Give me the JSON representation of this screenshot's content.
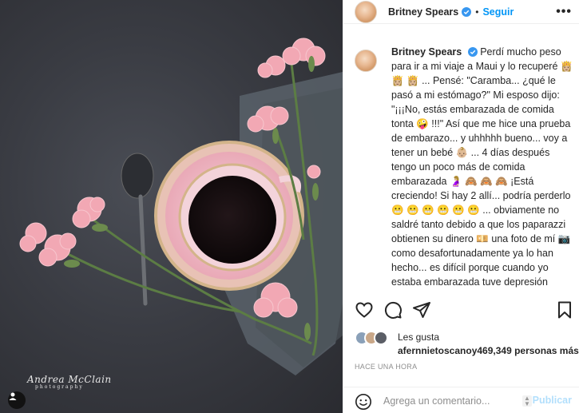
{
  "post": {
    "username": "Britney Spears",
    "follow_label": "Seguir",
    "separator": "•",
    "more_label": "•••",
    "caption": "Perdí mucho peso para ir a mi viaje a Maui y lo recuperé 👸🏼 👸🏼 👸🏼 ... Pensé: \"Caramba... ¿qué le pasó a mi estómago?\" Mi esposo dijo: \"¡¡¡No, estás embarazada de comida tonta 🤪 !!!\" Así que me hice una prueba de embarazo... y uhhhhh bueno... voy a tener un bebé 👶🏼 ... 4 días después tengo un poco más de comida embarazada 🤰🏼 🙈 🙈 🙈 ¡Está creciendo! Si hay 2 allí... podría perderlo 😬 😬 😬 😬 😬 😬 ... obviamente no saldré tanto debido a que los paparazzi obtienen su dinero 💴 una foto de mí 📷 como desafortunadamente ya lo han hecho... es difícil porque cuando yo estaba embarazada tuve depresión perinatal... tengo que decir que es absolutamente horrible 😢 ..."
  },
  "photo": {
    "watermark_name": "Andrea McClain",
    "watermark_sub": "photography"
  },
  "likes": {
    "label": "Les gusta",
    "first_user": "afernnietoscanoy",
    "count_text": "469,349 personas más"
  },
  "timestamp": "HACE UNA HORA",
  "comment": {
    "placeholder": "Agrega un comentario...",
    "publish_label": "Publicar"
  },
  "icons": [
    "verified-badge-icon",
    "more-options-icon",
    "heart-icon",
    "comment-icon",
    "share-icon",
    "bookmark-icon",
    "emoji-icon",
    "user-tag-icon"
  ],
  "colors": {
    "accent": "#0095f6",
    "publish_disabled": "#b2dffc",
    "muted": "#8e8e8e",
    "text": "#262626"
  }
}
